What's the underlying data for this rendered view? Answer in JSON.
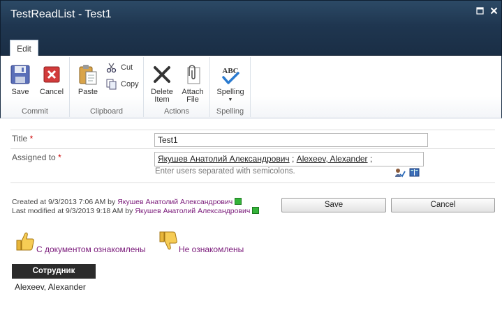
{
  "window": {
    "title": "TestReadList - Test1",
    "maximize_icon": "maximize-icon",
    "close_icon": "close-icon"
  },
  "ribbon": {
    "tab": "Edit",
    "groups": {
      "commit": {
        "label": "Commit",
        "save": "Save",
        "cancel": "Cancel"
      },
      "clipboard": {
        "label": "Clipboard",
        "paste": "Paste",
        "cut": "Cut",
        "copy": "Copy"
      },
      "actions": {
        "label": "Actions",
        "delete_line1": "Delete",
        "delete_line2": "Item",
        "attach_line1": "Attach",
        "attach_line2": "File"
      },
      "spelling": {
        "label": "Spelling",
        "spelling": "Spelling",
        "abc": "ABC"
      }
    }
  },
  "form": {
    "title_label": "Title",
    "title_value": "Test1",
    "assigned_label": "Assigned to",
    "required_mark": "*",
    "assigned_users": [
      "Якушев Анатолий Александрович",
      "Alexeev, Alexander"
    ],
    "separator": ";",
    "hint": "Enter users separated with semicolons."
  },
  "meta": {
    "created_prefix": "Created at 9/3/2013 7:06 AM by",
    "created_user": "Якушев Анатолий Александрович",
    "modified_prefix": "Last modified at 9/3/2013 9:18 AM by",
    "modified_user": "Якушев Анатолий Александрович"
  },
  "buttons": {
    "save": "Save",
    "cancel": "Cancel"
  },
  "acknowledge": {
    "yes": "С документом ознакомлены",
    "no": "Не ознакомлены"
  },
  "table": {
    "header": "Сотрудник",
    "rows": [
      "Alexeev, Alexander"
    ]
  },
  "colors": {
    "titlebar": "#1f3650",
    "link": "#7a1a7a",
    "presence": "#35b33a"
  }
}
